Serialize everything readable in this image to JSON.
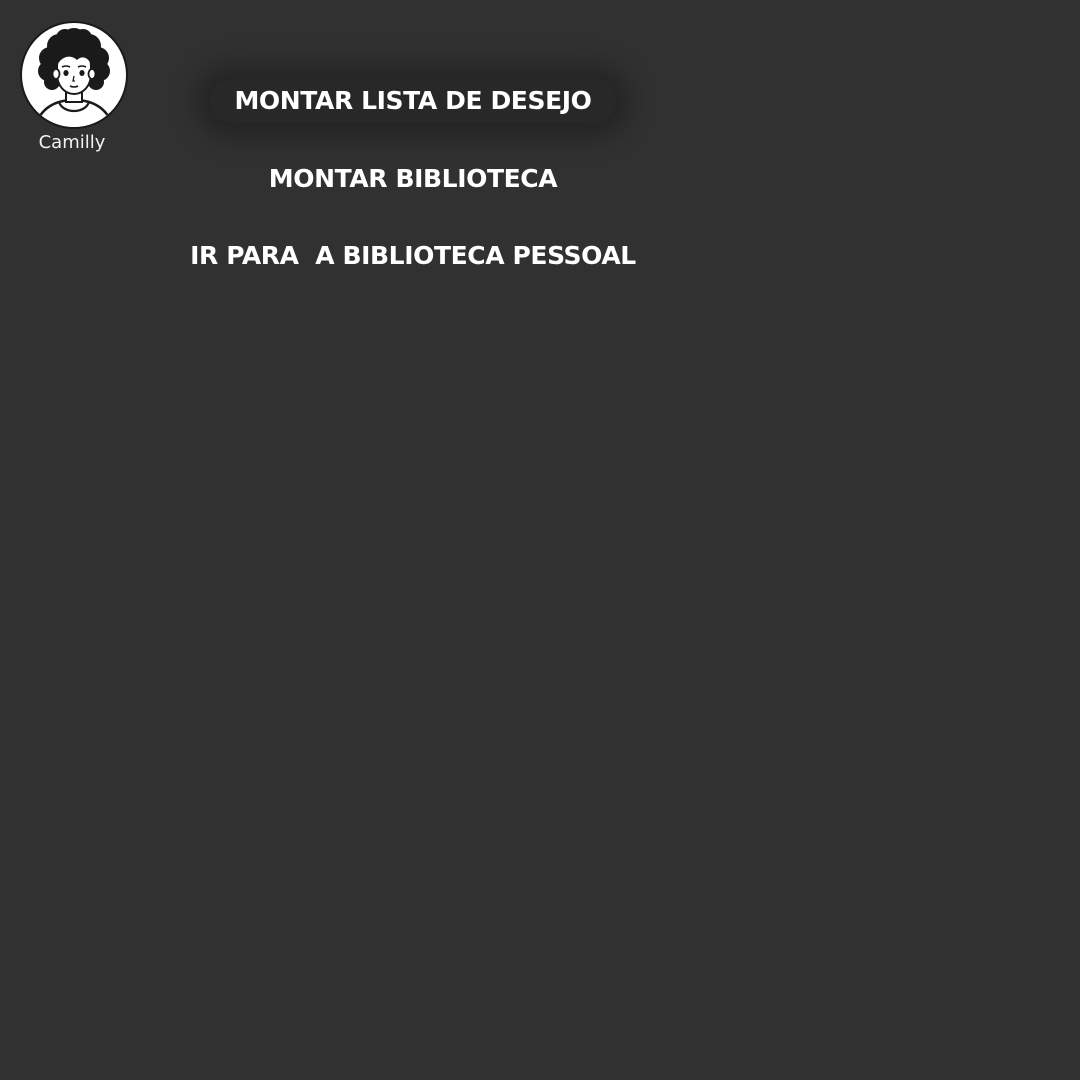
{
  "user": {
    "name": "Camilly",
    "avatar_icon": "woman-portrait-icon"
  },
  "menu": {
    "items": [
      {
        "label": "MONTAR LISTA DE DESEJO",
        "active": true
      },
      {
        "label": "MONTAR BIBLIOTECA",
        "active": false
      },
      {
        "label": "IR PARA  A BIBLIOTECA PESSOAL",
        "active": false
      }
    ]
  },
  "colors": {
    "background": "#313131",
    "text": "#ffffff",
    "avatar_outline": "#1a1a1a"
  }
}
